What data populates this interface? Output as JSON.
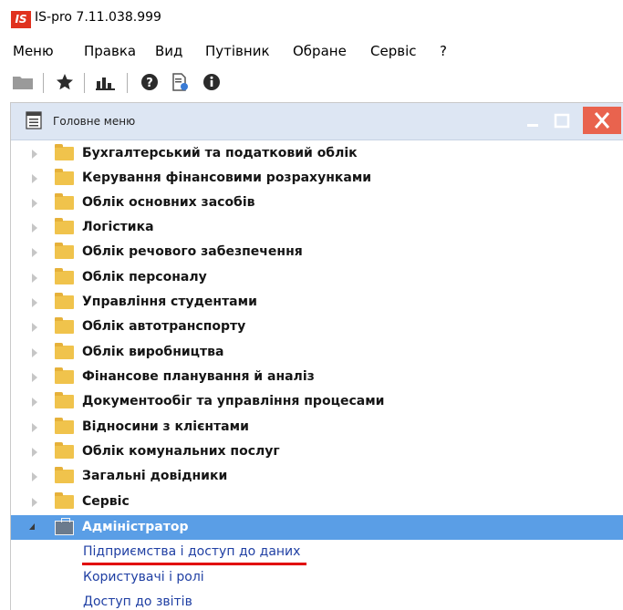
{
  "window": {
    "title": "IS-pro 7.11.038.999",
    "logo_text": "IS"
  },
  "menubar": {
    "items": [
      "Меню",
      "Правка",
      "Вид",
      "Путівник",
      "Обране",
      "Сервіс",
      "?"
    ]
  },
  "toolbar": {
    "icons": [
      "folder-icon",
      "star-icon",
      "chart-icon",
      "help-icon",
      "document-info-icon",
      "info-icon"
    ]
  },
  "panel": {
    "title": "Головне меню",
    "controls": {
      "minimize": "_",
      "maximize": "□",
      "close": "✕"
    }
  },
  "tree": {
    "groups": [
      "Бухгалтерський та податковий облік",
      "Керування фінансовими розрахунками",
      "Облік основних засобів",
      "Логістика",
      "Облік речового забезпечення",
      "Облік персоналу",
      "Управління студентами",
      "Облік автотранспорту",
      "Облік виробництва",
      "Фінансове планування й аналіз",
      "Документообіг та управління процесами",
      "Відносини з клієнтами",
      "Облік комунальних послуг",
      "Загальні довідники",
      "Сервіс"
    ],
    "expanded": {
      "label": "Адміністратор",
      "children": [
        "Підприємства і доступ до даних",
        "Користувачі і ролі",
        "Доступ до звітів"
      ]
    }
  },
  "colors": {
    "selection": "#5a9ee6",
    "link": "#1f3fa3",
    "underline": "#e10000",
    "close_button": "#e9634e",
    "logo": "#e0321f"
  }
}
